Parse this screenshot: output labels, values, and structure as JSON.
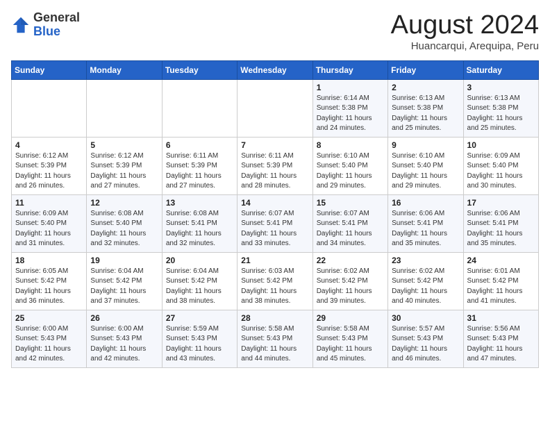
{
  "header": {
    "logo_general": "General",
    "logo_blue": "Blue",
    "month_title": "August 2024",
    "location": "Huancarqui, Arequipa, Peru"
  },
  "days_of_week": [
    "Sunday",
    "Monday",
    "Tuesday",
    "Wednesday",
    "Thursday",
    "Friday",
    "Saturday"
  ],
  "weeks": [
    [
      {
        "day": "",
        "info": ""
      },
      {
        "day": "",
        "info": ""
      },
      {
        "day": "",
        "info": ""
      },
      {
        "day": "",
        "info": ""
      },
      {
        "day": "1",
        "info": "Sunrise: 6:14 AM\nSunset: 5:38 PM\nDaylight: 11 hours\nand 24 minutes."
      },
      {
        "day": "2",
        "info": "Sunrise: 6:13 AM\nSunset: 5:38 PM\nDaylight: 11 hours\nand 25 minutes."
      },
      {
        "day": "3",
        "info": "Sunrise: 6:13 AM\nSunset: 5:38 PM\nDaylight: 11 hours\nand 25 minutes."
      }
    ],
    [
      {
        "day": "4",
        "info": "Sunrise: 6:12 AM\nSunset: 5:39 PM\nDaylight: 11 hours\nand 26 minutes."
      },
      {
        "day": "5",
        "info": "Sunrise: 6:12 AM\nSunset: 5:39 PM\nDaylight: 11 hours\nand 27 minutes."
      },
      {
        "day": "6",
        "info": "Sunrise: 6:11 AM\nSunset: 5:39 PM\nDaylight: 11 hours\nand 27 minutes."
      },
      {
        "day": "7",
        "info": "Sunrise: 6:11 AM\nSunset: 5:39 PM\nDaylight: 11 hours\nand 28 minutes."
      },
      {
        "day": "8",
        "info": "Sunrise: 6:10 AM\nSunset: 5:40 PM\nDaylight: 11 hours\nand 29 minutes."
      },
      {
        "day": "9",
        "info": "Sunrise: 6:10 AM\nSunset: 5:40 PM\nDaylight: 11 hours\nand 29 minutes."
      },
      {
        "day": "10",
        "info": "Sunrise: 6:09 AM\nSunset: 5:40 PM\nDaylight: 11 hours\nand 30 minutes."
      }
    ],
    [
      {
        "day": "11",
        "info": "Sunrise: 6:09 AM\nSunset: 5:40 PM\nDaylight: 11 hours\nand 31 minutes."
      },
      {
        "day": "12",
        "info": "Sunrise: 6:08 AM\nSunset: 5:40 PM\nDaylight: 11 hours\nand 32 minutes."
      },
      {
        "day": "13",
        "info": "Sunrise: 6:08 AM\nSunset: 5:41 PM\nDaylight: 11 hours\nand 32 minutes."
      },
      {
        "day": "14",
        "info": "Sunrise: 6:07 AM\nSunset: 5:41 PM\nDaylight: 11 hours\nand 33 minutes."
      },
      {
        "day": "15",
        "info": "Sunrise: 6:07 AM\nSunset: 5:41 PM\nDaylight: 11 hours\nand 34 minutes."
      },
      {
        "day": "16",
        "info": "Sunrise: 6:06 AM\nSunset: 5:41 PM\nDaylight: 11 hours\nand 35 minutes."
      },
      {
        "day": "17",
        "info": "Sunrise: 6:06 AM\nSunset: 5:41 PM\nDaylight: 11 hours\nand 35 minutes."
      }
    ],
    [
      {
        "day": "18",
        "info": "Sunrise: 6:05 AM\nSunset: 5:42 PM\nDaylight: 11 hours\nand 36 minutes."
      },
      {
        "day": "19",
        "info": "Sunrise: 6:04 AM\nSunset: 5:42 PM\nDaylight: 11 hours\nand 37 minutes."
      },
      {
        "day": "20",
        "info": "Sunrise: 6:04 AM\nSunset: 5:42 PM\nDaylight: 11 hours\nand 38 minutes."
      },
      {
        "day": "21",
        "info": "Sunrise: 6:03 AM\nSunset: 5:42 PM\nDaylight: 11 hours\nand 38 minutes."
      },
      {
        "day": "22",
        "info": "Sunrise: 6:02 AM\nSunset: 5:42 PM\nDaylight: 11 hours\nand 39 minutes."
      },
      {
        "day": "23",
        "info": "Sunrise: 6:02 AM\nSunset: 5:42 PM\nDaylight: 11 hours\nand 40 minutes."
      },
      {
        "day": "24",
        "info": "Sunrise: 6:01 AM\nSunset: 5:42 PM\nDaylight: 11 hours\nand 41 minutes."
      }
    ],
    [
      {
        "day": "25",
        "info": "Sunrise: 6:00 AM\nSunset: 5:43 PM\nDaylight: 11 hours\nand 42 minutes."
      },
      {
        "day": "26",
        "info": "Sunrise: 6:00 AM\nSunset: 5:43 PM\nDaylight: 11 hours\nand 42 minutes."
      },
      {
        "day": "27",
        "info": "Sunrise: 5:59 AM\nSunset: 5:43 PM\nDaylight: 11 hours\nand 43 minutes."
      },
      {
        "day": "28",
        "info": "Sunrise: 5:58 AM\nSunset: 5:43 PM\nDaylight: 11 hours\nand 44 minutes."
      },
      {
        "day": "29",
        "info": "Sunrise: 5:58 AM\nSunset: 5:43 PM\nDaylight: 11 hours\nand 45 minutes."
      },
      {
        "day": "30",
        "info": "Sunrise: 5:57 AM\nSunset: 5:43 PM\nDaylight: 11 hours\nand 46 minutes."
      },
      {
        "day": "31",
        "info": "Sunrise: 5:56 AM\nSunset: 5:43 PM\nDaylight: 11 hours\nand 47 minutes."
      }
    ]
  ]
}
